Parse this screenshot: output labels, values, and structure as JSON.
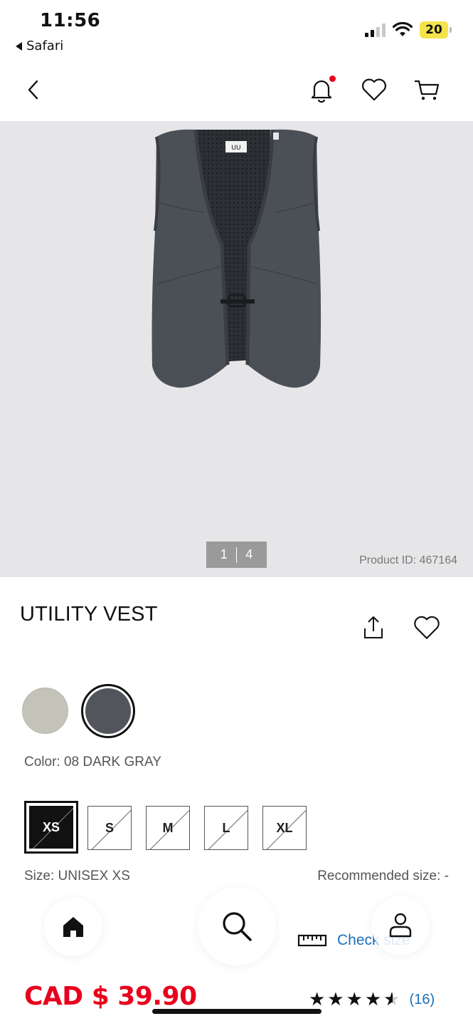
{
  "status_bar": {
    "time": "11:56",
    "back_app": "Safari",
    "battery": "20",
    "icons": [
      "cellular-signal-icon",
      "wifi-icon",
      "battery-icon"
    ]
  },
  "top_nav": {
    "icons": [
      "back-chevron-icon",
      "bell-icon",
      "heart-icon",
      "cart-icon"
    ],
    "notification_dot_color": "#e8001d"
  },
  "gallery": {
    "current": "1",
    "total": "4",
    "product_id": "Product ID: 467164",
    "image_logo": "UU"
  },
  "product": {
    "title": "UTILITY VEST"
  },
  "colors": {
    "options": [
      {
        "name": "light-gray",
        "hex": "#c4c3ba",
        "selected": false
      },
      {
        "name": "08 DARK GRAY",
        "hex": "#52565c",
        "selected": true
      }
    ],
    "label": "Color: 08 DARK GRAY"
  },
  "sizes": {
    "options": [
      "XS",
      "S",
      "M",
      "L",
      "XL"
    ],
    "selected": "XS",
    "label": "Size:  UNISEX XS",
    "recommended": "Recommended size: -"
  },
  "size_guide": {
    "link": "Check size"
  },
  "bottom_nav": {
    "icons": [
      "home-icon",
      "search-icon",
      "account-icon"
    ]
  },
  "price": {
    "text": "CAD $ 39.90",
    "color": "#e8001d"
  },
  "rating": {
    "stars": 4.5,
    "count": "(16)"
  }
}
